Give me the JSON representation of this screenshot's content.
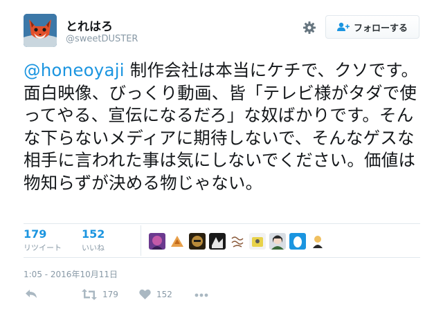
{
  "user": {
    "display_name": "とれはろ",
    "handle": "@sweetDUSTER"
  },
  "follow_button": {
    "label": "フォローする"
  },
  "tweet": {
    "mention": "@honeoyaji",
    "body": " 制作会社は本当にケチで、クソです。面白映像、びっくり動画、皆「テレビ様がタダで使ってやる、宣伝になるだろ」な奴ばかりです。そんな下らないメディアに期待しないで、そんなゲスな相手に言われた事は気にしないでください。価値は物知らずが決める物じゃない。"
  },
  "stats": {
    "retweets": {
      "count": "179",
      "label": "リツイート"
    },
    "likes": {
      "count": "152",
      "label": "いいね"
    }
  },
  "timestamp": "1:05 - 2016年10月11日",
  "actions": {
    "retweet_count": "179",
    "like_count": "152"
  },
  "icons": {
    "settings": "gear-icon",
    "follow": "person-plus-icon",
    "reply": "reply-icon",
    "retweet": "retweet-icon",
    "like": "heart-icon",
    "more": "more-icon"
  },
  "colors": {
    "accent": "#1b95e0",
    "muted": "#8899a6",
    "text": "#14171a"
  }
}
